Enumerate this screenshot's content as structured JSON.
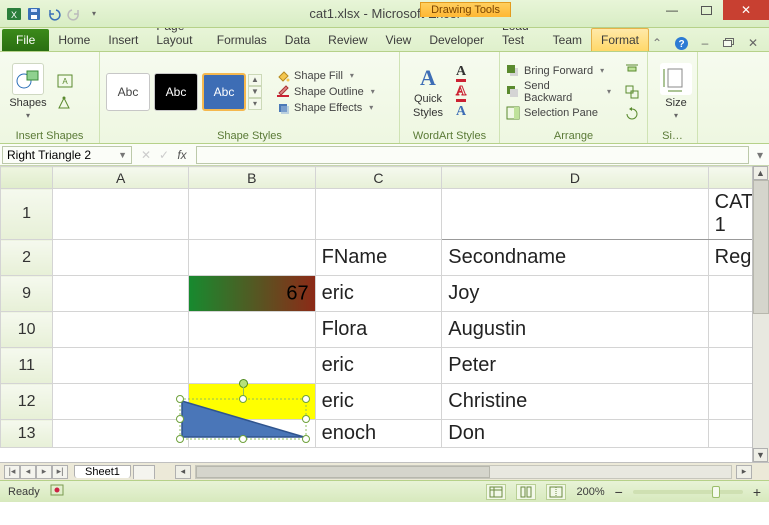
{
  "title": {
    "doc": "cat1.xlsx",
    "app": "Microsoft Excel",
    "sep": " - "
  },
  "context_tab": "Drawing Tools",
  "tabs": {
    "file": "File",
    "home": "Home",
    "insert": "Insert",
    "pagelayout": "Page Layout",
    "formulas": "Formulas",
    "data": "Data",
    "review": "Review",
    "view": "View",
    "developer": "Developer",
    "loadtest": "Load Test",
    "team": "Team",
    "format": "Format"
  },
  "ribbon": {
    "insert_shapes": {
      "label": "Insert Shapes",
      "shapes_btn": "Shapes"
    },
    "shape_styles": {
      "label": "Shape Styles",
      "swatch_text": "Abc",
      "fill": "Shape Fill",
      "outline": "Shape Outline",
      "effects": "Shape Effects"
    },
    "wordart": {
      "label": "WordArt Styles",
      "quick": "Quick",
      "styles": "Styles"
    },
    "arrange": {
      "label": "Arrange",
      "bring_forward": "Bring Forward",
      "send_backward": "Send Backward",
      "selection_pane": "Selection Pane"
    },
    "size": {
      "label": "Si…",
      "btn": "Size"
    }
  },
  "namebox": "Right Triangle 2",
  "fx_label": "fx",
  "columns": {
    "A": "A",
    "B": "B",
    "C": "C",
    "D": "D"
  },
  "rows": {
    "r1": "1",
    "r2": "2",
    "r9": "9",
    "r10": "10",
    "r11": "11",
    "r12": "12",
    "r13": "13"
  },
  "cells": {
    "d1": "CAT 1",
    "c2": "FName",
    "d2": "Secondname",
    "e2": "Reg",
    "b9": "67",
    "c9": "eric",
    "d9": "Joy",
    "c10": "Flora",
    "d10": "Augustin",
    "c11": "eric",
    "d11": "Peter",
    "c12": "eric",
    "d12": "Christine",
    "c13": "enoch",
    "d13": "Don"
  },
  "sheet_tab": "Sheet1",
  "status": {
    "ready": "Ready",
    "zoom": "200%"
  }
}
